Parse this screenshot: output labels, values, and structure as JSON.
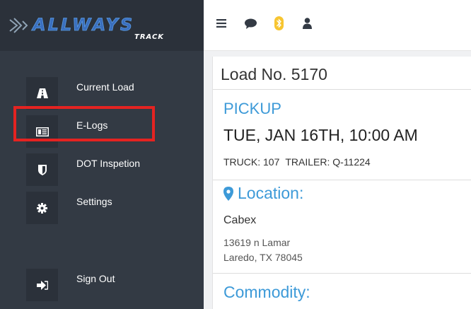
{
  "app": {
    "logo_text": "ALLWAYS TRACK"
  },
  "sidebar": {
    "items": [
      {
        "label": "Current Load",
        "icon": "road-icon"
      },
      {
        "label": "E-Logs",
        "icon": "logbook-icon"
      },
      {
        "label": "DOT Inspetion",
        "icon": "shield-icon"
      },
      {
        "label": "Settings",
        "icon": "gear-icon"
      },
      {
        "label": "Sign Out",
        "icon": "sign-out-icon"
      }
    ],
    "highlighted_item": "E-Logs"
  },
  "topbar": {
    "icons": [
      "menu-icon",
      "chat-icon",
      "bluetooth-icon",
      "user-icon"
    ]
  },
  "load": {
    "title": "Load No. 5170",
    "section_label": "PICKUP",
    "datetime": "TUE, JAN 16TH, 10:00 AM",
    "truck": "TRUCK: 107",
    "trailer": "TRAILER: Q-11224",
    "location_heading": "Location:",
    "company": "Cabex",
    "address_line1": "13619 n Lamar",
    "address_line2": "Laredo, TX 78045",
    "commodity_heading": "Commodity:"
  },
  "colors": {
    "sidebar_bg": "#333a44",
    "accent_blue": "#3d9ad8",
    "highlight_red": "#e52321",
    "bluetooth_yellow": "#f7c531"
  }
}
